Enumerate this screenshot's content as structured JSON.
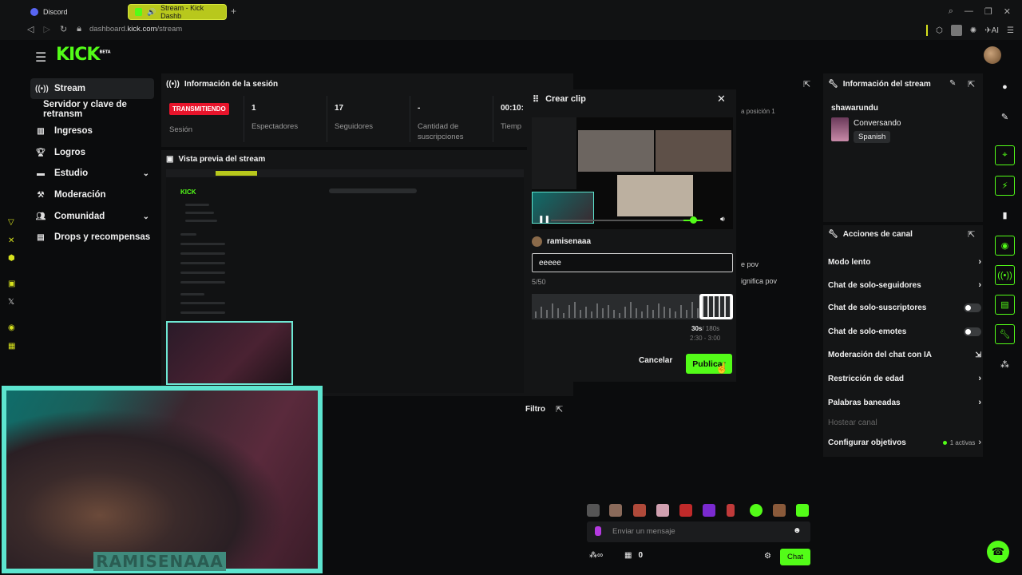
{
  "browser": {
    "tabs": [
      {
        "label": "Discord",
        "icon": "discord-icon"
      },
      {
        "label": "Stream - Kick Dashb",
        "icon": "kick-icon"
      }
    ],
    "url_prefix": "dashboard.",
    "url_domain": "kick.com",
    "url_path": "/stream",
    "ai_label": "AI"
  },
  "app": {
    "logo": "KICK",
    "logo_sup": "BETA"
  },
  "sidebar": {
    "items": [
      {
        "label": "Stream",
        "icon": "stream-icon",
        "active": true
      },
      {
        "label": "Servidor y clave de retransm",
        "icon": "",
        "active": false
      },
      {
        "label": "Ingresos",
        "icon": "chart-icon",
        "active": false
      },
      {
        "label": "Logros",
        "icon": "trophy-icon",
        "active": false
      },
      {
        "label": "Estudio",
        "icon": "studio-icon",
        "active": false,
        "expandable": true
      },
      {
        "label": "Moderación",
        "icon": "hammer-icon",
        "active": false
      },
      {
        "label": "Comunidad",
        "icon": "people-icon",
        "active": false,
        "expandable": true
      },
      {
        "label": "Drops y recompensas",
        "icon": "gift-icon",
        "active": false
      }
    ]
  },
  "session": {
    "title": "Información de la sesión",
    "live_badge": "TRANSMITIENDO",
    "session_label": "Sesión",
    "viewers": "1",
    "viewers_label": "Espectadores",
    "followers": "17",
    "followers_label": "Seguidores",
    "subs": "-",
    "subs_label_1": "Cantidad de",
    "subs_label_2": "suscripciones",
    "time": "00:10:",
    "time_label": "Tiemp"
  },
  "preview": {
    "title": "Vista previa del stream",
    "filter_label": "Filtro",
    "cam_name": "RAMISENAAA"
  },
  "hidden_chat_fragments": [
    "a posición 1",
    "e pov",
    "ignifica pov"
  ],
  "clip": {
    "title": "Crear clip",
    "username": "ramisenaaa",
    "input_value": "eeeee",
    "char_count": "5/50",
    "duration": "30s",
    "duration_max": "/ 180s",
    "range": "2:30 - 3:00",
    "cancel_label": "Cancelar",
    "publish_label": "Publicar"
  },
  "stream_info": {
    "title": "Información del stream",
    "streamer": "shawarundu",
    "category": "Conversando",
    "language_tag": "Spanish"
  },
  "channel_actions": {
    "title": "Acciones de canal",
    "items": [
      {
        "label": "Modo lento",
        "control": "chevron"
      },
      {
        "label": "Chat de solo-seguidores",
        "control": "chevron"
      },
      {
        "label": "Chat de solo-suscriptores",
        "control": "toggle",
        "on": false
      },
      {
        "label": "Chat de solo-emotes",
        "control": "toggle",
        "on": false
      },
      {
        "label": "Moderación del chat con IA",
        "control": "external"
      },
      {
        "label": "Restricción de edad",
        "control": "chevron"
      },
      {
        "label": "Palabras baneadas",
        "control": "chevron"
      },
      {
        "label": "Hostear canal",
        "control": "none",
        "disabled": true
      },
      {
        "label": "Configurar objetivos",
        "control": "chevron",
        "meta": "1 activas"
      }
    ]
  },
  "chat": {
    "placeholder": "Enviar un mensaje",
    "points": "0",
    "send_label": "Chat"
  },
  "colors": {
    "brand": "#53fc18",
    "live": "#e8142b",
    "webcam_border": "#5de5cf"
  }
}
